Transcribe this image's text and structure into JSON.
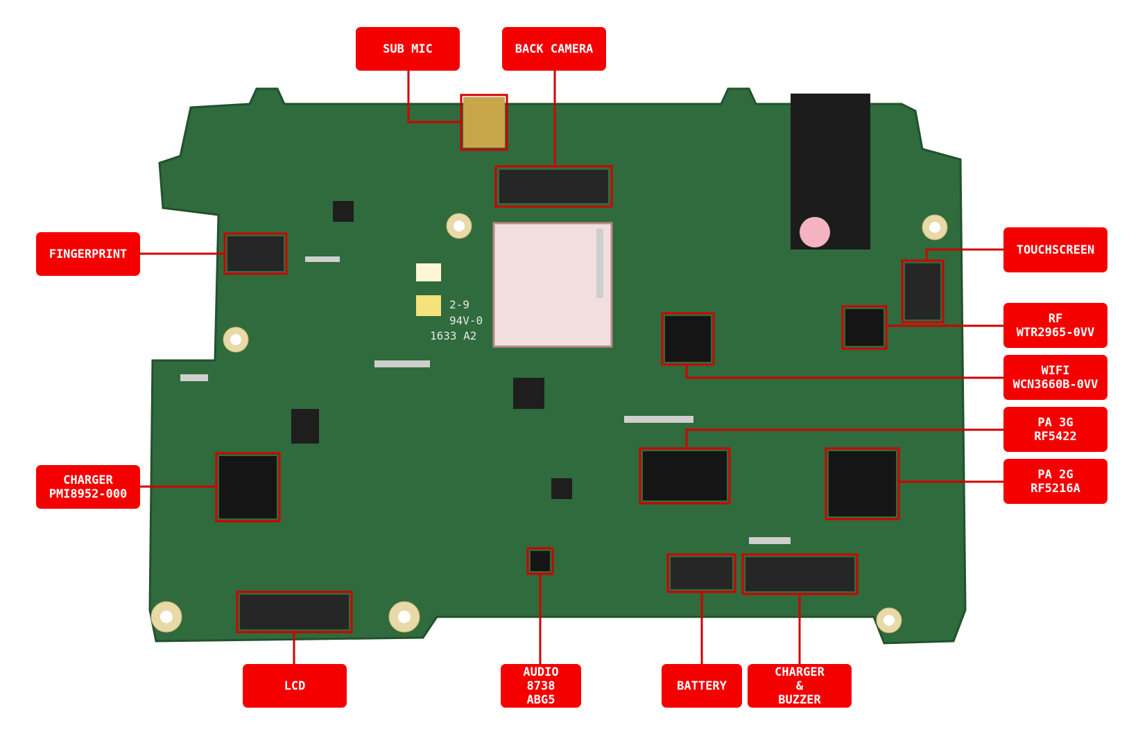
{
  "colors": {
    "label_bg": "#f40000",
    "label_text": "#ffffff",
    "board": "#2f6b3c",
    "highlight": "#d00000"
  },
  "labels": {
    "sub_mic": [
      "SUB MIC"
    ],
    "back_camera": [
      "BACK CAMERA"
    ],
    "fingerprint": [
      "FINGERPRINT"
    ],
    "touchscreen": [
      "TOUCHSCREEN"
    ],
    "rf": [
      "RF",
      "WTR2965-0VV"
    ],
    "wifi": [
      "WIFI",
      "WCN3660B-0VV"
    ],
    "pa_3g": [
      "PA 3G",
      "RF5422"
    ],
    "pa_2g": [
      "PA 2G",
      "RF5216A"
    ],
    "charger": [
      "CHARGER",
      "PMI8952-000"
    ],
    "lcd": [
      "LCD"
    ],
    "audio": [
      "AUDIO",
      "8738",
      "ABG5"
    ],
    "battery": [
      "BATTERY"
    ],
    "charger_buzzer": [
      "CHARGER",
      "&",
      "BUZZER"
    ]
  },
  "board_markings": [
    "2-9",
    "94V-0",
    "1633 A2"
  ]
}
